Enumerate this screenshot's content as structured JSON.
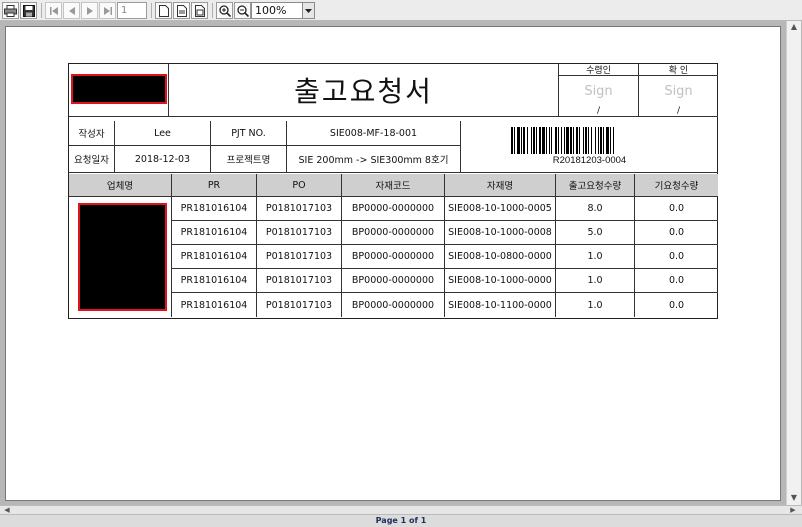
{
  "toolbar": {
    "page_number": "1",
    "zoom": "100%",
    "icons": [
      "printer-icon",
      "save-icon",
      "first-page-icon",
      "prev-page-icon",
      "next-page-icon",
      "last-page-icon",
      "single-page-icon",
      "fit-width-icon",
      "fit-page-icon",
      "zoom-in-icon",
      "zoom-out-icon"
    ]
  },
  "report": {
    "title": "출고요청서",
    "approval": {
      "receiver_label": "수령인",
      "confirm_label": "확 인",
      "sign_text": "Sign",
      "date_sep": "/"
    },
    "info": {
      "author_label": "작성자",
      "author_value": "Lee",
      "pjt_label": "PJT NO.",
      "pjt_value": "SIE008-MF-18-001",
      "request_date_label": "요청일자",
      "request_date_value": "2018-12-03",
      "project_label": "프로젝트명",
      "project_value": "SIE 200mm -> SIE300mm 8호기",
      "barcode_text": "R20181203-0004"
    },
    "table": {
      "headers": [
        "업체명",
        "PR",
        "PO",
        "자재코드",
        "자재명",
        "출고요청수량",
        "기요청수량"
      ],
      "rows": [
        [
          "PR181016104",
          "P0181017103",
          "BP0000-0000000",
          "SIE008-10-1000-0005",
          "8.0",
          "0.0"
        ],
        [
          "PR181016104",
          "P0181017103",
          "BP0000-0000000",
          "SIE008-10-1000-0008",
          "5.0",
          "0.0"
        ],
        [
          "PR181016104",
          "P0181017103",
          "BP0000-0000000",
          "SIE008-10-0800-0000",
          "1.0",
          "0.0"
        ],
        [
          "PR181016104",
          "P0181017103",
          "BP0000-0000000",
          "SIE008-10-1000-0000",
          "1.0",
          "0.0"
        ],
        [
          "PR181016104",
          "P0181017103",
          "BP0000-0000000",
          "SIE008-10-1100-0000",
          "1.0",
          "0.0"
        ]
      ]
    }
  },
  "status": {
    "page_indicator": "Page 1 of 1"
  },
  "colors": {
    "redaction_border": "#e0131a",
    "header_fill": "#cfcfcf",
    "status_text": "#20305c"
  }
}
